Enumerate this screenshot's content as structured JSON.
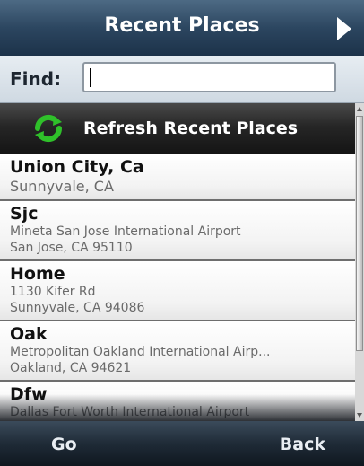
{
  "header": {
    "title": "Recent Places",
    "next_icon": "arrow-right-icon"
  },
  "find": {
    "label": "Find:",
    "value": ""
  },
  "refresh": {
    "label": "Refresh Recent Places",
    "icon": "refresh-icon",
    "icon_color": "#2fc02a"
  },
  "places": [
    {
      "name": "Union City, Ca",
      "lines": [
        "Sunnyvale, CA"
      ]
    },
    {
      "name": "Sjc",
      "lines": [
        "Mineta San Jose International Airport",
        "San Jose, CA 95110"
      ]
    },
    {
      "name": "Home",
      "lines": [
        "1130 Kifer Rd",
        "Sunnyvale, CA 94086"
      ]
    },
    {
      "name": "Oak",
      "lines": [
        "Metropolitan Oakland International Airp...",
        "Oakland, CA 94621"
      ]
    },
    {
      "name": "Dfw",
      "lines": [
        "Dallas Fort Worth International Airport"
      ]
    }
  ],
  "softkeys": {
    "left": "Go",
    "right": "Back"
  }
}
